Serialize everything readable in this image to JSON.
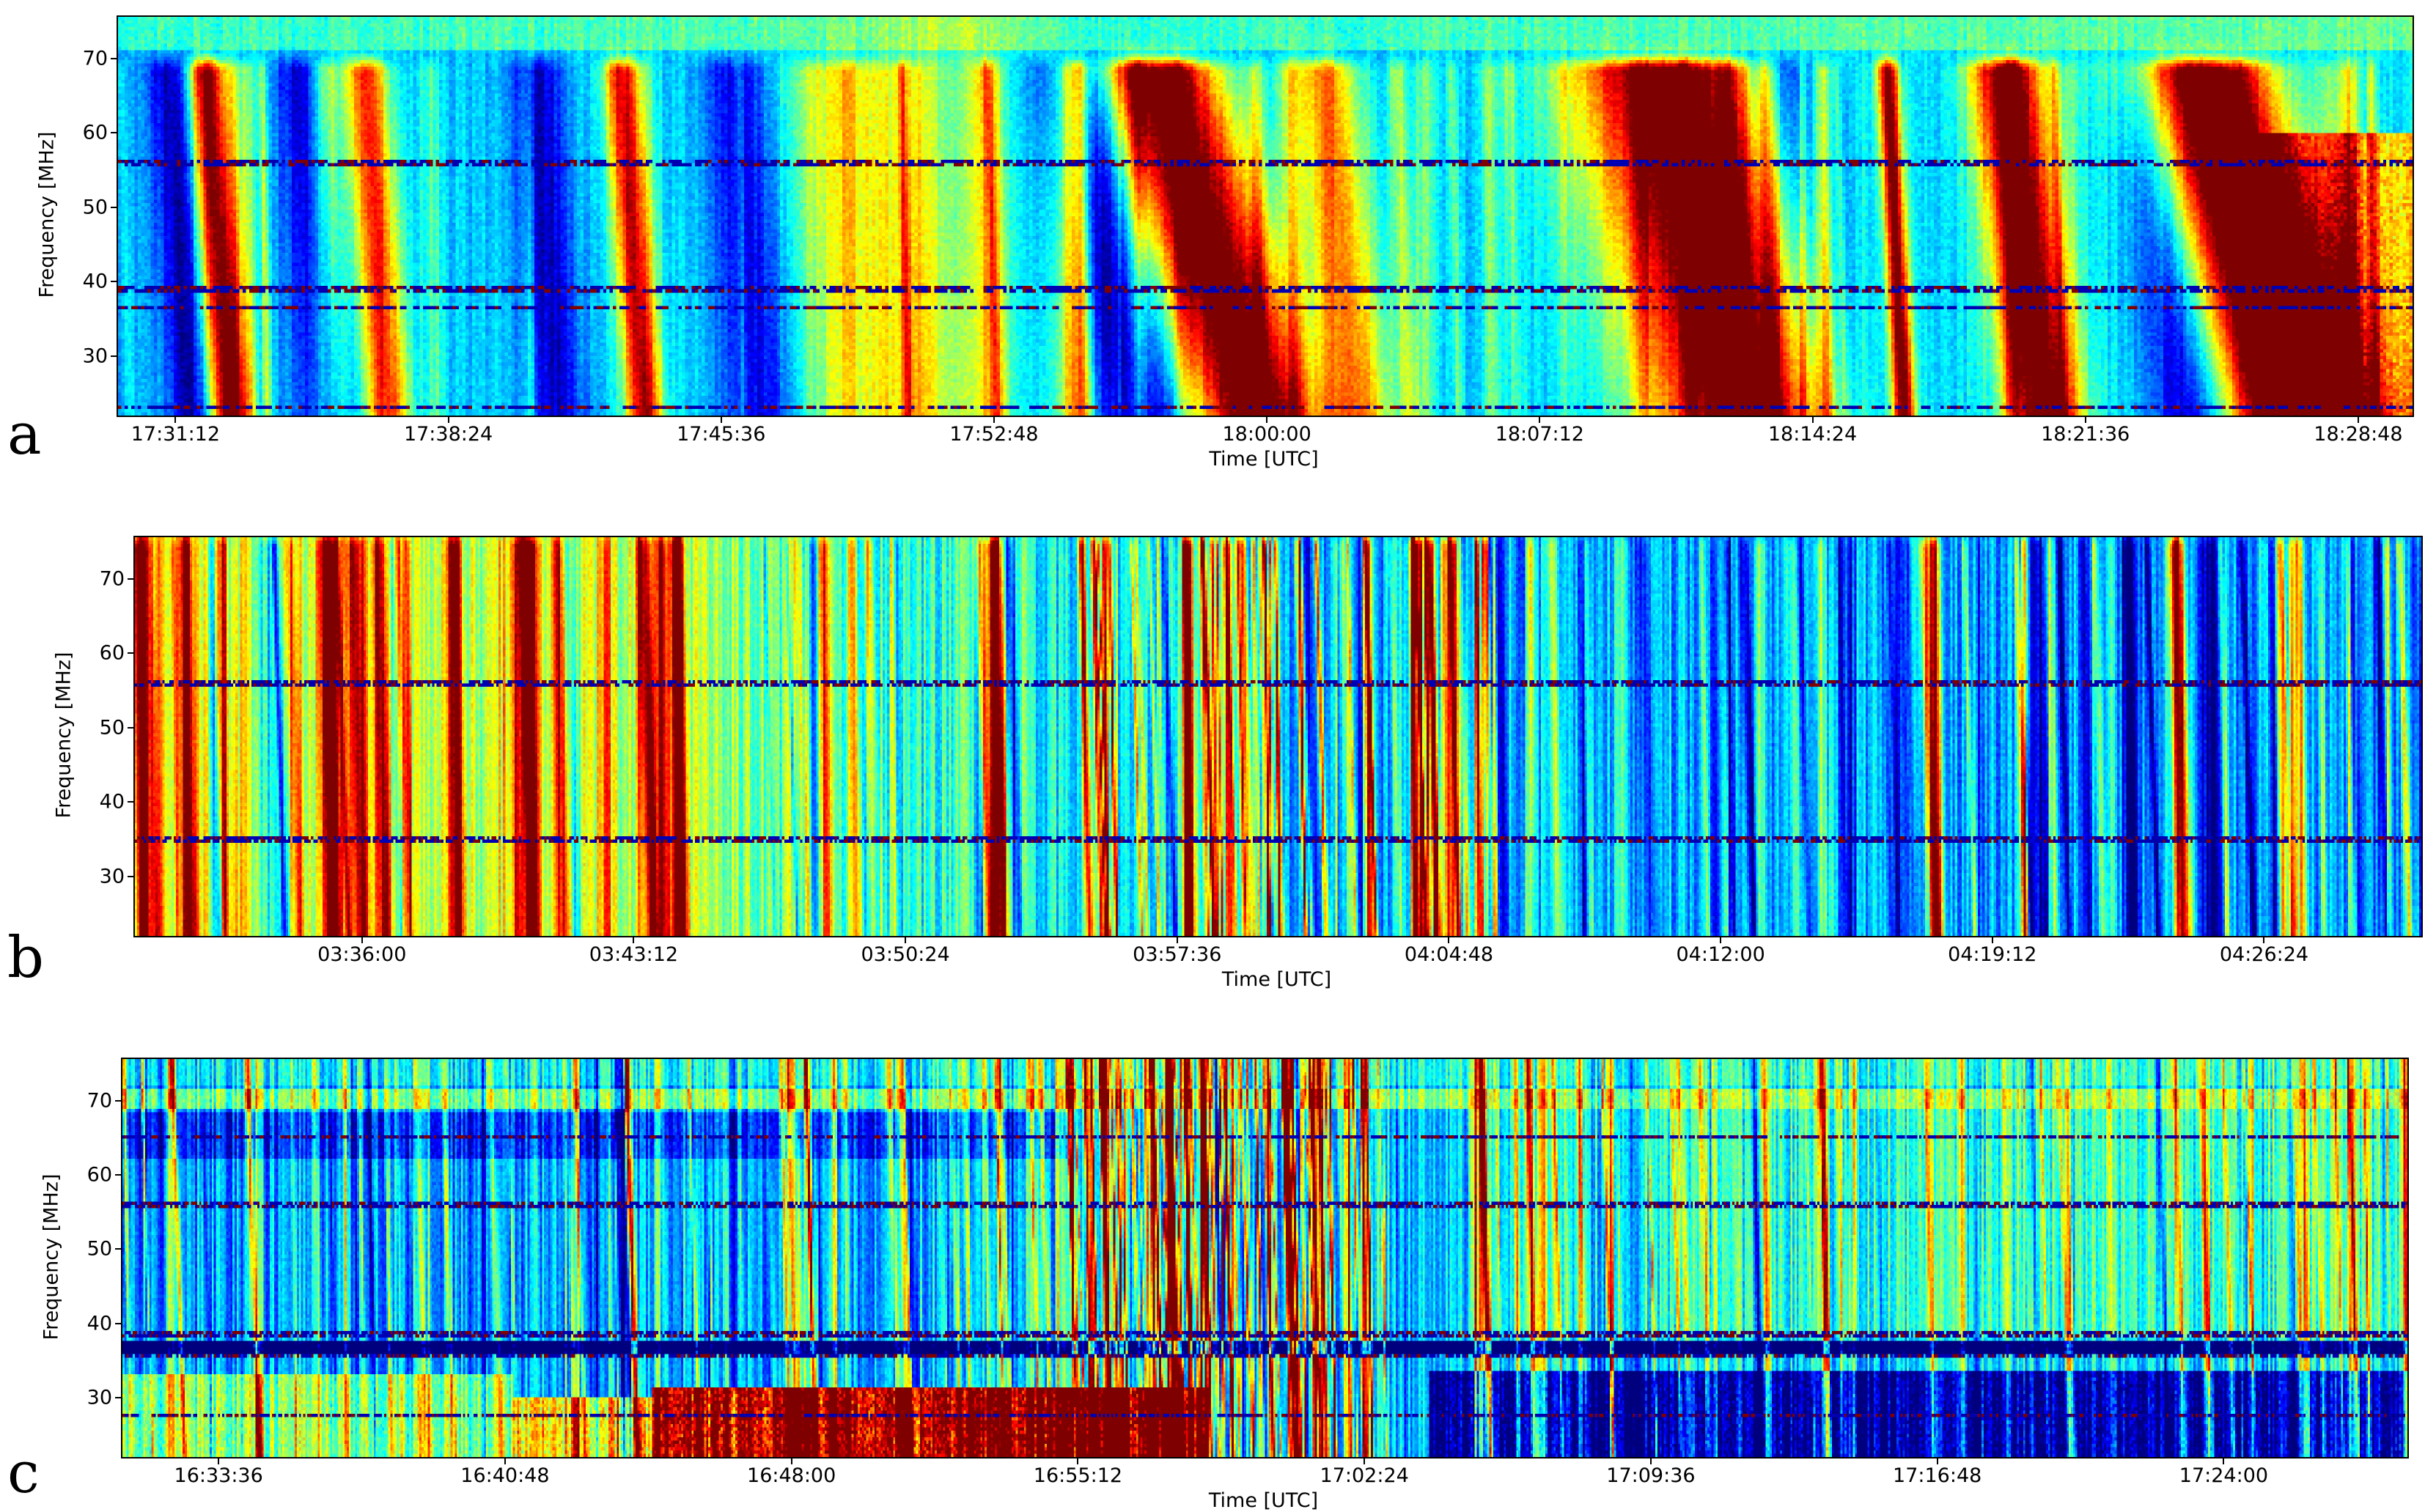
{
  "chart_data": [
    {
      "type": "heatmap",
      "panel_label": "a",
      "xlabel": "Time [UTC]",
      "ylabel": "Frequency [MHz]",
      "time_range": [
        "17:29:41",
        "18:30:14"
      ],
      "freq_range_mhz": [
        22,
        75.6
      ],
      "x_ticks": [
        "17:31:12",
        "17:38:24",
        "17:45:36",
        "17:52:48",
        "18:00:00",
        "18:07:12",
        "18:14:24",
        "18:21:36",
        "18:28:48"
      ],
      "y_ticks": [
        30,
        40,
        50,
        60,
        70
      ],
      "colormap": "jet",
      "seed": 11,
      "background": [
        {
          "t": "17:29:41",
          "level": 0.3
        },
        {
          "t": "17:48:00",
          "level": 0.34
        },
        {
          "t": "17:52:00",
          "level": 0.45
        },
        {
          "t": "17:55:00",
          "level": 0.3
        },
        {
          "t": "18:30:14",
          "level": 0.36
        }
      ],
      "striation": 0.08,
      "burst_top_mhz": 68,
      "bursts": [
        {
          "t": "17:32:16",
          "width_s": 22,
          "level": 0.75,
          "drift_s": 40
        },
        {
          "t": "17:36:27",
          "width_s": 25,
          "level": 0.55,
          "drift_s": 40
        },
        {
          "t": "17:43:13",
          "width_s": 20,
          "level": 0.6,
          "drift_s": 40
        },
        {
          "t": "17:49:30",
          "width_s": 90,
          "level": 0.25,
          "drift_s": 60
        },
        {
          "t": "17:58:12",
          "width_s": 70,
          "level": 0.8,
          "drift_s": 180
        },
        {
          "t": "18:01:53",
          "width_s": 40,
          "level": 0.45,
          "drift_s": 60
        },
        {
          "t": "18:11:31",
          "width_s": 110,
          "level": 0.8,
          "drift_s": 150
        },
        {
          "t": "18:16:34",
          "width_s": 12,
          "level": 0.7,
          "drift_s": 30
        },
        {
          "t": "18:19:56",
          "width_s": 40,
          "level": 0.75,
          "drift_s": 70
        },
        {
          "t": "18:25:41",
          "width_s": 80,
          "level": 0.85,
          "drift_s": 200
        }
      ],
      "dark_lanes": [
        {
          "t": "17:31:19",
          "width_s": 25,
          "level": -0.28,
          "drift_s": 40
        },
        {
          "t": "17:34:49",
          "width_s": 30,
          "level": -0.25,
          "drift_s": 40
        },
        {
          "t": "17:40:58",
          "width_s": 30,
          "level": -0.25,
          "drift_s": 40
        },
        {
          "t": "17:46:18",
          "width_s": 40,
          "level": -0.25,
          "drift_s": 40
        },
        {
          "t": "17:55:44",
          "width_s": 50,
          "level": -0.3,
          "drift_s": 120
        },
        {
          "t": "18:14:11",
          "width_s": 60,
          "level": -0.3,
          "drift_s": 80
        },
        {
          "t": "18:23:37",
          "width_s": 40,
          "level": -0.3,
          "drift_s": 80
        }
      ],
      "regions": [
        {
          "t0": "18:26:00",
          "t1": "18:30:14",
          "f": [
            22,
            60
          ],
          "level": 0.3
        },
        {
          "t0": "17:29:41",
          "t1": "18:30:14",
          "f": [
            71,
            75.6
          ],
          "level": 0.12
        }
      ],
      "random_bursts": [
        {
          "t0": "17:29:41",
          "t1": "18:30:14",
          "count": 60,
          "width_s": [
            4,
            14
          ],
          "level": [
            0.05,
            0.25
          ]
        }
      ],
      "rfi_lines_mhz": [
        56,
        39,
        36.5,
        23
      ]
    },
    {
      "type": "heatmap",
      "panel_label": "b",
      "xlabel": "Time [UTC]",
      "ylabel": "Frequency [MHz]",
      "time_range": [
        "03:29:59",
        "04:30:34"
      ],
      "freq_range_mhz": [
        22,
        75.6
      ],
      "x_ticks": [
        "03:36:00",
        "03:43:12",
        "03:50:24",
        "03:57:36",
        "04:04:48",
        "04:12:00",
        "04:19:12",
        "04:26:24"
      ],
      "y_ticks": [
        30,
        40,
        50,
        60,
        70
      ],
      "colormap": "jet",
      "seed": 23,
      "background": [
        {
          "t": "03:29:59",
          "level": 0.6
        },
        {
          "t": "03:44:00",
          "level": 0.55
        },
        {
          "t": "03:50:00",
          "level": 0.42
        },
        {
          "t": "03:56:00",
          "level": 0.34
        },
        {
          "t": "04:00:00",
          "level": 0.3
        },
        {
          "t": "04:30:34",
          "level": 0.28
        }
      ],
      "striation": 0.22,
      "burst_top_mhz": 74,
      "bursts": [
        {
          "t": "03:30:09",
          "width_s": 8,
          "level": 0.5,
          "drift_s": 10
        },
        {
          "t": "03:31:23",
          "width_s": 8,
          "level": 0.45,
          "drift_s": 10
        },
        {
          "t": "03:32:25",
          "width_s": 10,
          "level": 0.35,
          "drift_s": 10
        },
        {
          "t": "03:35:05",
          "width_s": 10,
          "level": 0.4,
          "drift_s": 10
        },
        {
          "t": "03:35:55",
          "width_s": 10,
          "level": 0.4,
          "drift_s": 10
        },
        {
          "t": "03:36:32",
          "width_s": 8,
          "level": 0.45,
          "drift_s": 10
        },
        {
          "t": "03:38:35",
          "width_s": 10,
          "level": 0.3,
          "drift_s": 10
        },
        {
          "t": "03:41:16",
          "width_s": 8,
          "level": 0.3,
          "drift_s": 10
        },
        {
          "t": "03:43:32",
          "width_s": 10,
          "level": 0.4,
          "drift_s": 10
        },
        {
          "t": "03:48:16",
          "width_s": 6,
          "level": 0.45,
          "drift_s": 5
        },
        {
          "t": "03:49:05",
          "width_s": 6,
          "level": 0.45,
          "drift_s": 5
        },
        {
          "t": "03:52:47",
          "width_s": 8,
          "level": 0.5,
          "drift_s": 10
        },
        {
          "t": "03:57:56",
          "width_s": 6,
          "level": 0.65,
          "drift_s": 5
        },
        {
          "t": "03:58:58",
          "width_s": 6,
          "level": 0.65,
          "drift_s": 5
        },
        {
          "t": "04:02:40",
          "width_s": 5,
          "level": 0.6,
          "drift_s": 5
        },
        {
          "t": "04:03:54",
          "width_s": 5,
          "level": 0.6,
          "drift_s": 5
        },
        {
          "t": "04:17:42",
          "width_s": 7,
          "level": 0.65,
          "drift_s": 8
        },
        {
          "t": "04:24:05",
          "width_s": 7,
          "level": 0.45,
          "drift_s": 8
        },
        {
          "t": "04:27:22",
          "width_s": 6,
          "level": 0.45,
          "drift_s": 8
        }
      ],
      "dark_lanes": [
        {
          "t": "03:33:40",
          "width_s": 12,
          "level": -0.3,
          "drift_s": 10
        },
        {
          "t": "03:59:40",
          "width_s": 10,
          "level": -0.3,
          "drift_s": 5
        },
        {
          "t": "04:20:30",
          "width_s": 12,
          "level": -0.25,
          "drift_s": 5
        },
        {
          "t": "04:25:00",
          "width_s": 12,
          "level": -0.25,
          "drift_s": 5
        }
      ],
      "regions": [],
      "random_bursts": [
        {
          "t0": "03:29:59",
          "t1": "04:30:34",
          "count": 170,
          "width_s": [
            2,
            8
          ],
          "level": [
            -0.3,
            0.45
          ]
        },
        {
          "t0": "03:55:00",
          "t1": "04:06:00",
          "count": 60,
          "width_s": [
            1,
            3
          ],
          "level": [
            0.2,
            0.6
          ]
        }
      ],
      "rfi_lines_mhz": [
        56,
        35
      ]
    },
    {
      "type": "heatmap",
      "panel_label": "c",
      "xlabel": "Time [UTC]",
      "ylabel": "Frequency [MHz]",
      "time_range": [
        "16:31:11",
        "17:28:37"
      ],
      "freq_range_mhz": [
        22,
        75.6
      ],
      "x_ticks": [
        "16:33:36",
        "16:40:48",
        "16:48:00",
        "16:55:12",
        "17:02:24",
        "17:09:36",
        "17:16:48",
        "17:24:00"
      ],
      "y_ticks": [
        30,
        40,
        50,
        60,
        70
      ],
      "colormap": "jet",
      "seed": 37,
      "background": [
        {
          "t": "16:31:11",
          "level": 0.27
        },
        {
          "t": "16:55:00",
          "level": 0.3
        },
        {
          "t": "17:28:37",
          "level": 0.36
        }
      ],
      "striation": 0.25,
      "burst_top_mhz": 75,
      "bursts": [],
      "dark_lanes": [],
      "regions": [
        {
          "t0": "16:31:11",
          "t1": "17:28:37",
          "f": [
            69,
            71.5
          ],
          "level": 0.2
        },
        {
          "t0": "16:31:11",
          "t1": "17:28:37",
          "f": [
            72,
            75.6
          ],
          "level": 0.08
        },
        {
          "t0": "16:31:11",
          "t1": "16:55:00",
          "f": [
            62,
            68.5
          ],
          "level": -0.12
        },
        {
          "t0": "16:31:11",
          "t1": "17:28:37",
          "f": [
            35.8,
            37.8
          ],
          "level": -0.5
        },
        {
          "t0": "16:31:11",
          "t1": "16:41:00",
          "f": [
            22,
            33
          ],
          "level": 0.22
        },
        {
          "t0": "16:41:00",
          "t1": "16:44:30",
          "f": [
            22,
            30
          ],
          "level": 0.35
        },
        {
          "t0": "16:44:30",
          "t1": "16:58:30",
          "f": [
            22,
            31.5
          ],
          "level": 0.65
        },
        {
          "t0": "17:04:00",
          "t1": "17:28:37",
          "f": [
            22,
            33.5
          ],
          "level": -0.3
        },
        {
          "t0": "17:05:00",
          "t1": "17:28:37",
          "f": [
            38,
            69
          ],
          "level": 0.08
        }
      ],
      "random_bursts": [
        {
          "t0": "16:31:11",
          "t1": "17:28:37",
          "count": 320,
          "width_s": [
            1,
            4
          ],
          "level": [
            -0.2,
            0.4
          ]
        },
        {
          "t0": "16:55:00",
          "t1": "17:03:00",
          "count": 90,
          "width_s": [
            0.5,
            2
          ],
          "level": [
            0.3,
            0.7
          ]
        }
      ],
      "rfi_lines_mhz": [
        65,
        56,
        38.5,
        35.5,
        27.5
      ]
    }
  ]
}
